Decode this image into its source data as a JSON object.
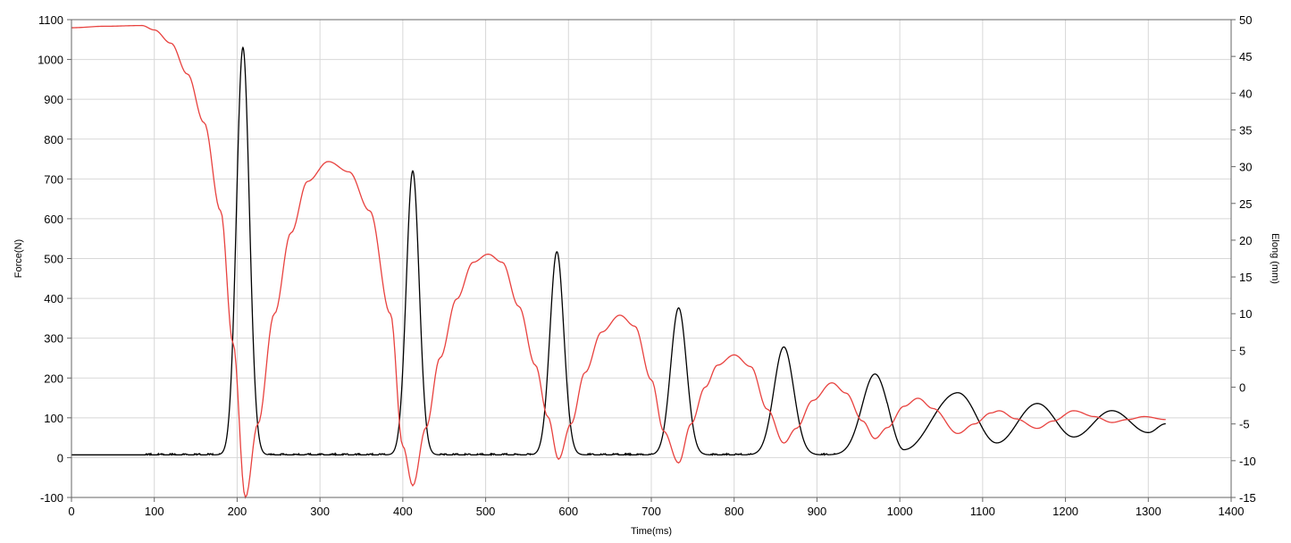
{
  "chart_data": {
    "type": "line",
    "title": "",
    "xlabel": "Time(ms)",
    "ylabel_left": "Force(N)",
    "ylabel_right": "Elong (mm)",
    "xlim": [
      0,
      1400
    ],
    "ylim_left": [
      -100,
      1100
    ],
    "ylim_right": [
      -15,
      50
    ],
    "x_ticks": [
      0,
      100,
      200,
      300,
      400,
      500,
      600,
      700,
      800,
      900,
      1000,
      1100,
      1200,
      1300,
      1400
    ],
    "y_left_ticks": [
      -100,
      0,
      100,
      200,
      300,
      400,
      500,
      600,
      700,
      800,
      900,
      1000,
      1100
    ],
    "y_right_ticks": [
      -15,
      -10,
      -5,
      0,
      5,
      10,
      15,
      20,
      25,
      30,
      35,
      40,
      45,
      50
    ],
    "grid": true,
    "legend": "none",
    "series": [
      {
        "axis": "left",
        "color": "#000000",
        "peaks": [
          {
            "t": 207,
            "v": 1030,
            "w": 13
          },
          {
            "t": 412,
            "v": 720,
            "w": 13
          },
          {
            "t": 586,
            "v": 517,
            "w": 14
          },
          {
            "t": 733,
            "v": 376,
            "w": 16
          },
          {
            "t": 860,
            "v": 278,
            "w": 20
          },
          {
            "t": 970,
            "v": 210,
            "w": 26
          },
          {
            "t": 1070,
            "v": 163,
            "w": 30
          },
          {
            "t": 1166,
            "v": 136,
            "w": 30
          },
          {
            "t": 1256,
            "v": 118,
            "w": 30
          },
          {
            "t": 1320,
            "v": 85,
            "w": 25
          }
        ],
        "valleys": [
          {
            "t": 1005,
            "v": 20
          },
          {
            "t": 1117,
            "v": 37
          },
          {
            "t": 1210,
            "v": 52
          },
          {
            "t": 1300,
            "v": 63
          }
        ],
        "baseline": 7,
        "baseline_start": 90
      },
      {
        "axis": "right",
        "color": "#e8423f",
        "points": [
          [
            0,
            48.9
          ],
          [
            40,
            49.1
          ],
          [
            85,
            49.2
          ],
          [
            100,
            48.6
          ],
          [
            120,
            46.8
          ],
          [
            140,
            42.6
          ],
          [
            160,
            36
          ],
          [
            180,
            24
          ],
          [
            195,
            6
          ],
          [
            210,
            -15
          ],
          [
            225,
            -5
          ],
          [
            245,
            10
          ],
          [
            265,
            21
          ],
          [
            285,
            28
          ],
          [
            310,
            30.7
          ],
          [
            335,
            29.3
          ],
          [
            360,
            24
          ],
          [
            385,
            10
          ],
          [
            400,
            -8
          ],
          [
            412,
            -13.4
          ],
          [
            428,
            -5.5
          ],
          [
            445,
            4
          ],
          [
            465,
            12
          ],
          [
            485,
            17
          ],
          [
            503,
            18.1
          ],
          [
            520,
            17
          ],
          [
            540,
            11
          ],
          [
            560,
            3
          ],
          [
            575,
            -4
          ],
          [
            588,
            -9.8
          ],
          [
            603,
            -5
          ],
          [
            620,
            2
          ],
          [
            640,
            7.5
          ],
          [
            662,
            9.8
          ],
          [
            680,
            8.3
          ],
          [
            700,
            1
          ],
          [
            715,
            -6
          ],
          [
            733,
            -10.3
          ],
          [
            748,
            -5
          ],
          [
            765,
            0
          ],
          [
            780,
            3
          ],
          [
            800,
            4.4
          ],
          [
            820,
            2.8
          ],
          [
            840,
            -3
          ],
          [
            860,
            -7.6
          ],
          [
            875,
            -5.6
          ],
          [
            895,
            -1.8
          ],
          [
            918,
            0.6
          ],
          [
            935,
            -0.8
          ],
          [
            955,
            -4.6
          ],
          [
            970,
            -7
          ],
          [
            985,
            -5.5
          ],
          [
            1005,
            -2.6
          ],
          [
            1022,
            -1.5
          ],
          [
            1040,
            -2.9
          ],
          [
            1070,
            -6.3
          ],
          [
            1090,
            -5
          ],
          [
            1110,
            -3.5
          ],
          [
            1120,
            -3.2
          ],
          [
            1140,
            -4.3
          ],
          [
            1166,
            -5.6
          ],
          [
            1185,
            -4.6
          ],
          [
            1210,
            -3.2
          ],
          [
            1235,
            -4
          ],
          [
            1256,
            -4.8
          ],
          [
            1275,
            -4.4
          ],
          [
            1295,
            -4
          ],
          [
            1321,
            -4.4
          ]
        ]
      }
    ]
  }
}
